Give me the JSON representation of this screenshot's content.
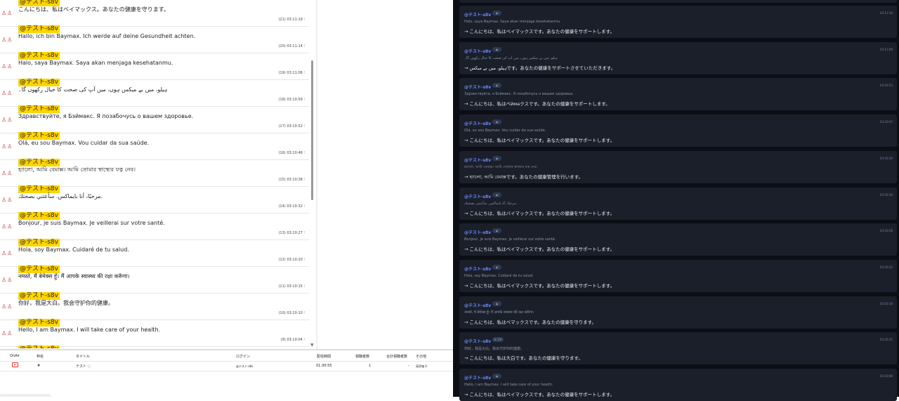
{
  "comments": [
    {
      "name": "@テスト-s8v",
      "text": "こんにちは、私はベイマックス。あなたの健康を守ります。",
      "num": "(21)",
      "time": "03:11:19"
    },
    {
      "name": "@テスト-s8v",
      "text": "Hallo, ich bin Baymax. Ich werde auf deine Gesundheit achten.",
      "num": "(20)",
      "time": "03:11:14"
    },
    {
      "name": "@テスト-s8v",
      "text": "Halo, saya Baymax. Saya akan menjaga kesehatanmu.",
      "num": "(19)",
      "time": "03:11:08"
    },
    {
      "name": "@テスト-s8v",
      "text": "ہیلو، میں بے میکس ہوں، میں آپ کی صحت کا خیال رکھوں گا۔",
      "num": "(18)",
      "time": "03:10:59"
    },
    {
      "name": "@テスト-s8v",
      "text": "Здравствуйте, я Бэймакс. Я позабочусь о вашем здоровье.",
      "num": "(17)",
      "time": "03:10:52"
    },
    {
      "name": "@テスト-s8v",
      "text": "Olá, eu sou Baymax. Vou cuidar da sua saúde.",
      "num": "(16)",
      "time": "03:10:46"
    },
    {
      "name": "@テスト-s8v",
      "text": "হ্যালো, আমি বেমাক্স। আমি তোমার স্বাস্থ্যের যত্ন নেব।",
      "num": "(15)",
      "time": "03:10:38"
    },
    {
      "name": "@テスト-s8v",
      "text": "مرحبًا، أنا بايماكس. سأعتني بصحتك.",
      "num": "(14)",
      "time": "03:10:32"
    },
    {
      "name": "@テスト-s8v",
      "text": "Bonjour, je suis Baymax. Je veillerai sur votre santé.",
      "num": "(13)",
      "time": "03:10:27"
    },
    {
      "name": "@テスト-s8v",
      "text": "Hola, soy Baymax. Cuidaré de tu salud.",
      "num": "(12)",
      "time": "03:10:20"
    },
    {
      "name": "@テスト-s8v",
      "text": "नमस्ते, मैं बेमेक्स हूँ। मैं आपके स्वास्थ्य की रक्षा करूँगा।",
      "num": "(11)",
      "time": "03:10:15"
    },
    {
      "name": "@テスト-s8v",
      "text": "你好，我是大白。我会守护你的健康。",
      "num": "(10)",
      "time": "03:10:10"
    },
    {
      "name": "@テスト-s8v",
      "text": "Hello, I am Baymax. I will take care of your health.",
      "num": "(9)",
      "time": "03:10:04"
    },
    {
      "name": "@テスト-s8v",
      "text": "",
      "num": "",
      "time": ""
    }
  ],
  "stream_table": {
    "headers": [
      "OnAir",
      "枠名",
      "タイトル",
      "ログイン",
      "配信時間",
      "視聴者数",
      "合計視聴者数",
      "その他"
    ],
    "row": {
      "frame": "#",
      "title": "テスト ◌",
      "login": "@テスト-s8v",
      "duration": "01:30:55",
      "viewers": "1",
      "total": "-",
      "other": "高評価 0"
    }
  },
  "cards": [
    {
      "name": "@テスト-s8v",
      "badge": "◉",
      "time": "03:11:10",
      "orig": "Halo, saya Baymax. Saya akan menjaga kesehatanmu.",
      "trans": "→ こんにちは、私はベイマックスです。あなたの健康をサポートします。"
    },
    {
      "name": "@テスト-s8v",
      "badge": "◉",
      "time": "03:11:00",
      "orig": "ہیلو، میں بے میکس ہوں، میں آپ کی صحت کا خیال رکھوں گا۔",
      "trans": "→ ہیلو، میں بے میکسです。あなたの健康をサポートさせていただきます。"
    },
    {
      "name": "@テスト-s8v",
      "badge": "◉",
      "time": "03:10:53",
      "orig": "Здравствуйте, я Бэймакс. Я позабочусь о вашем здоровье.",
      "trans": "→ こんにちは、私はベймаクスです。あなたの健康をサポートします。"
    },
    {
      "name": "@テスト-s8v",
      "badge": "◉",
      "time": "03:10:47",
      "orig": "Olá, eu sou Baymax. Vou cuidar da sua saúde.",
      "trans": "→ こんにちは、私はベイマックスです。あなたの健康をサポートします。"
    },
    {
      "name": "@テスト-s8v",
      "badge": "◉",
      "time": "03:10:39",
      "orig": "হ্যালো, আমি বেমাক্স। আমি তোমার স্বাস্থ্যের যত্ন নেব।",
      "trans": "→ হ্যালো, আমি বেমাক্সです。あなたの健康管理を行います。"
    },
    {
      "name": "@テスト-s8v",
      "badge": "◉",
      "time": "03:10:34",
      "orig": "مرحبًا، أنا بايماكس. سأعتني بصحتك.",
      "trans": "→ こんにちは、私はバイマックスです。あなたの健康をサポートします。"
    },
    {
      "name": "@テスト-s8v",
      "badge": "◉",
      "time": "03:10:28",
      "orig": "Bonjour, je suis Baymax. Je veillerai sur votre santé.",
      "trans": "→ こんにちは、私はベイマックスです。あなたの健康をサポートします。"
    },
    {
      "name": "@テスト-s8v",
      "badge": "◉",
      "time": "03:10:22",
      "orig": "Hola, soy Baymax. Cuidaré de tu salud.",
      "trans": "→ こんにちは、私はベイマックスです。あなたの健康をサポートします。"
    },
    {
      "name": "@テスト-s8v",
      "badge": "◉",
      "time": "03:10:16",
      "orig": "नमस्ते, मैं बेमेक्स हूँ। मैं आपके स्वास्थ्य की रक्षा करूँगा।",
      "trans": "→ こんにちは、私はベマックスです。あなたの健康を守ります。"
    },
    {
      "name": "@テスト-s8v",
      "badge": "zh ZH",
      "time": "03:10:11",
      "orig": "你好，我是大白。我会守护你的健康。",
      "trans": "→ こんにちは、私は大白です。あなたの健康を守ります。"
    },
    {
      "name": "@テスト-s8v",
      "badge": "◉",
      "time": "03:10:08",
      "orig": "Hello, I am Baymax. I will take care of your health.",
      "trans": "→ こんにちは、私はベイマックスです。あなたの健康をサポートします。"
    }
  ]
}
